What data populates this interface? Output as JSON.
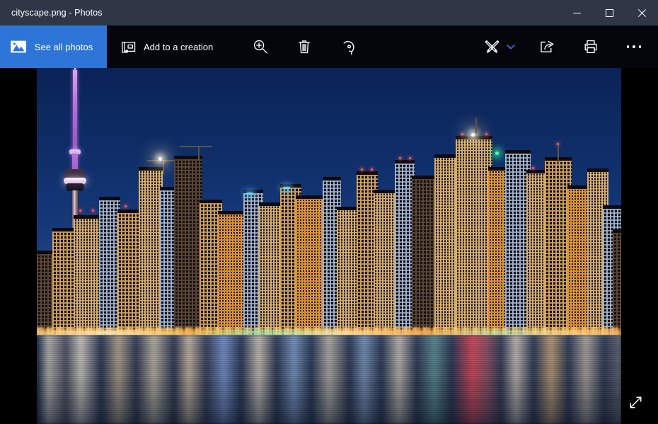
{
  "window": {
    "title": "cityscape.png - Photos",
    "controls": [
      {
        "name": "minimize",
        "label": "Minimize"
      },
      {
        "name": "maximize",
        "label": "Maximize"
      },
      {
        "name": "close",
        "label": "Close"
      }
    ]
  },
  "toolbar": {
    "see_all_photos": "See all photos",
    "add_to_creation": "Add to a creation",
    "zoom": "Zoom",
    "delete": "Delete",
    "rotate": "Rotate",
    "edit_create": "Edit & Create",
    "share": "Share",
    "print": "Print",
    "more": "See more"
  },
  "viewer": {
    "expand_label": "Enter fullscreen",
    "image_name": "cityscape.png",
    "image_description": "Toronto skyline at blue hour with the CN Tower lit purple and city lights reflecting on Lake Ontario"
  },
  "colors": {
    "titlebar": "#2f3747",
    "toolbar": "#04060c",
    "accent": "#2d75d6",
    "chevron": "#2d75d6",
    "text": "#ffffff",
    "stage": "#000000"
  }
}
